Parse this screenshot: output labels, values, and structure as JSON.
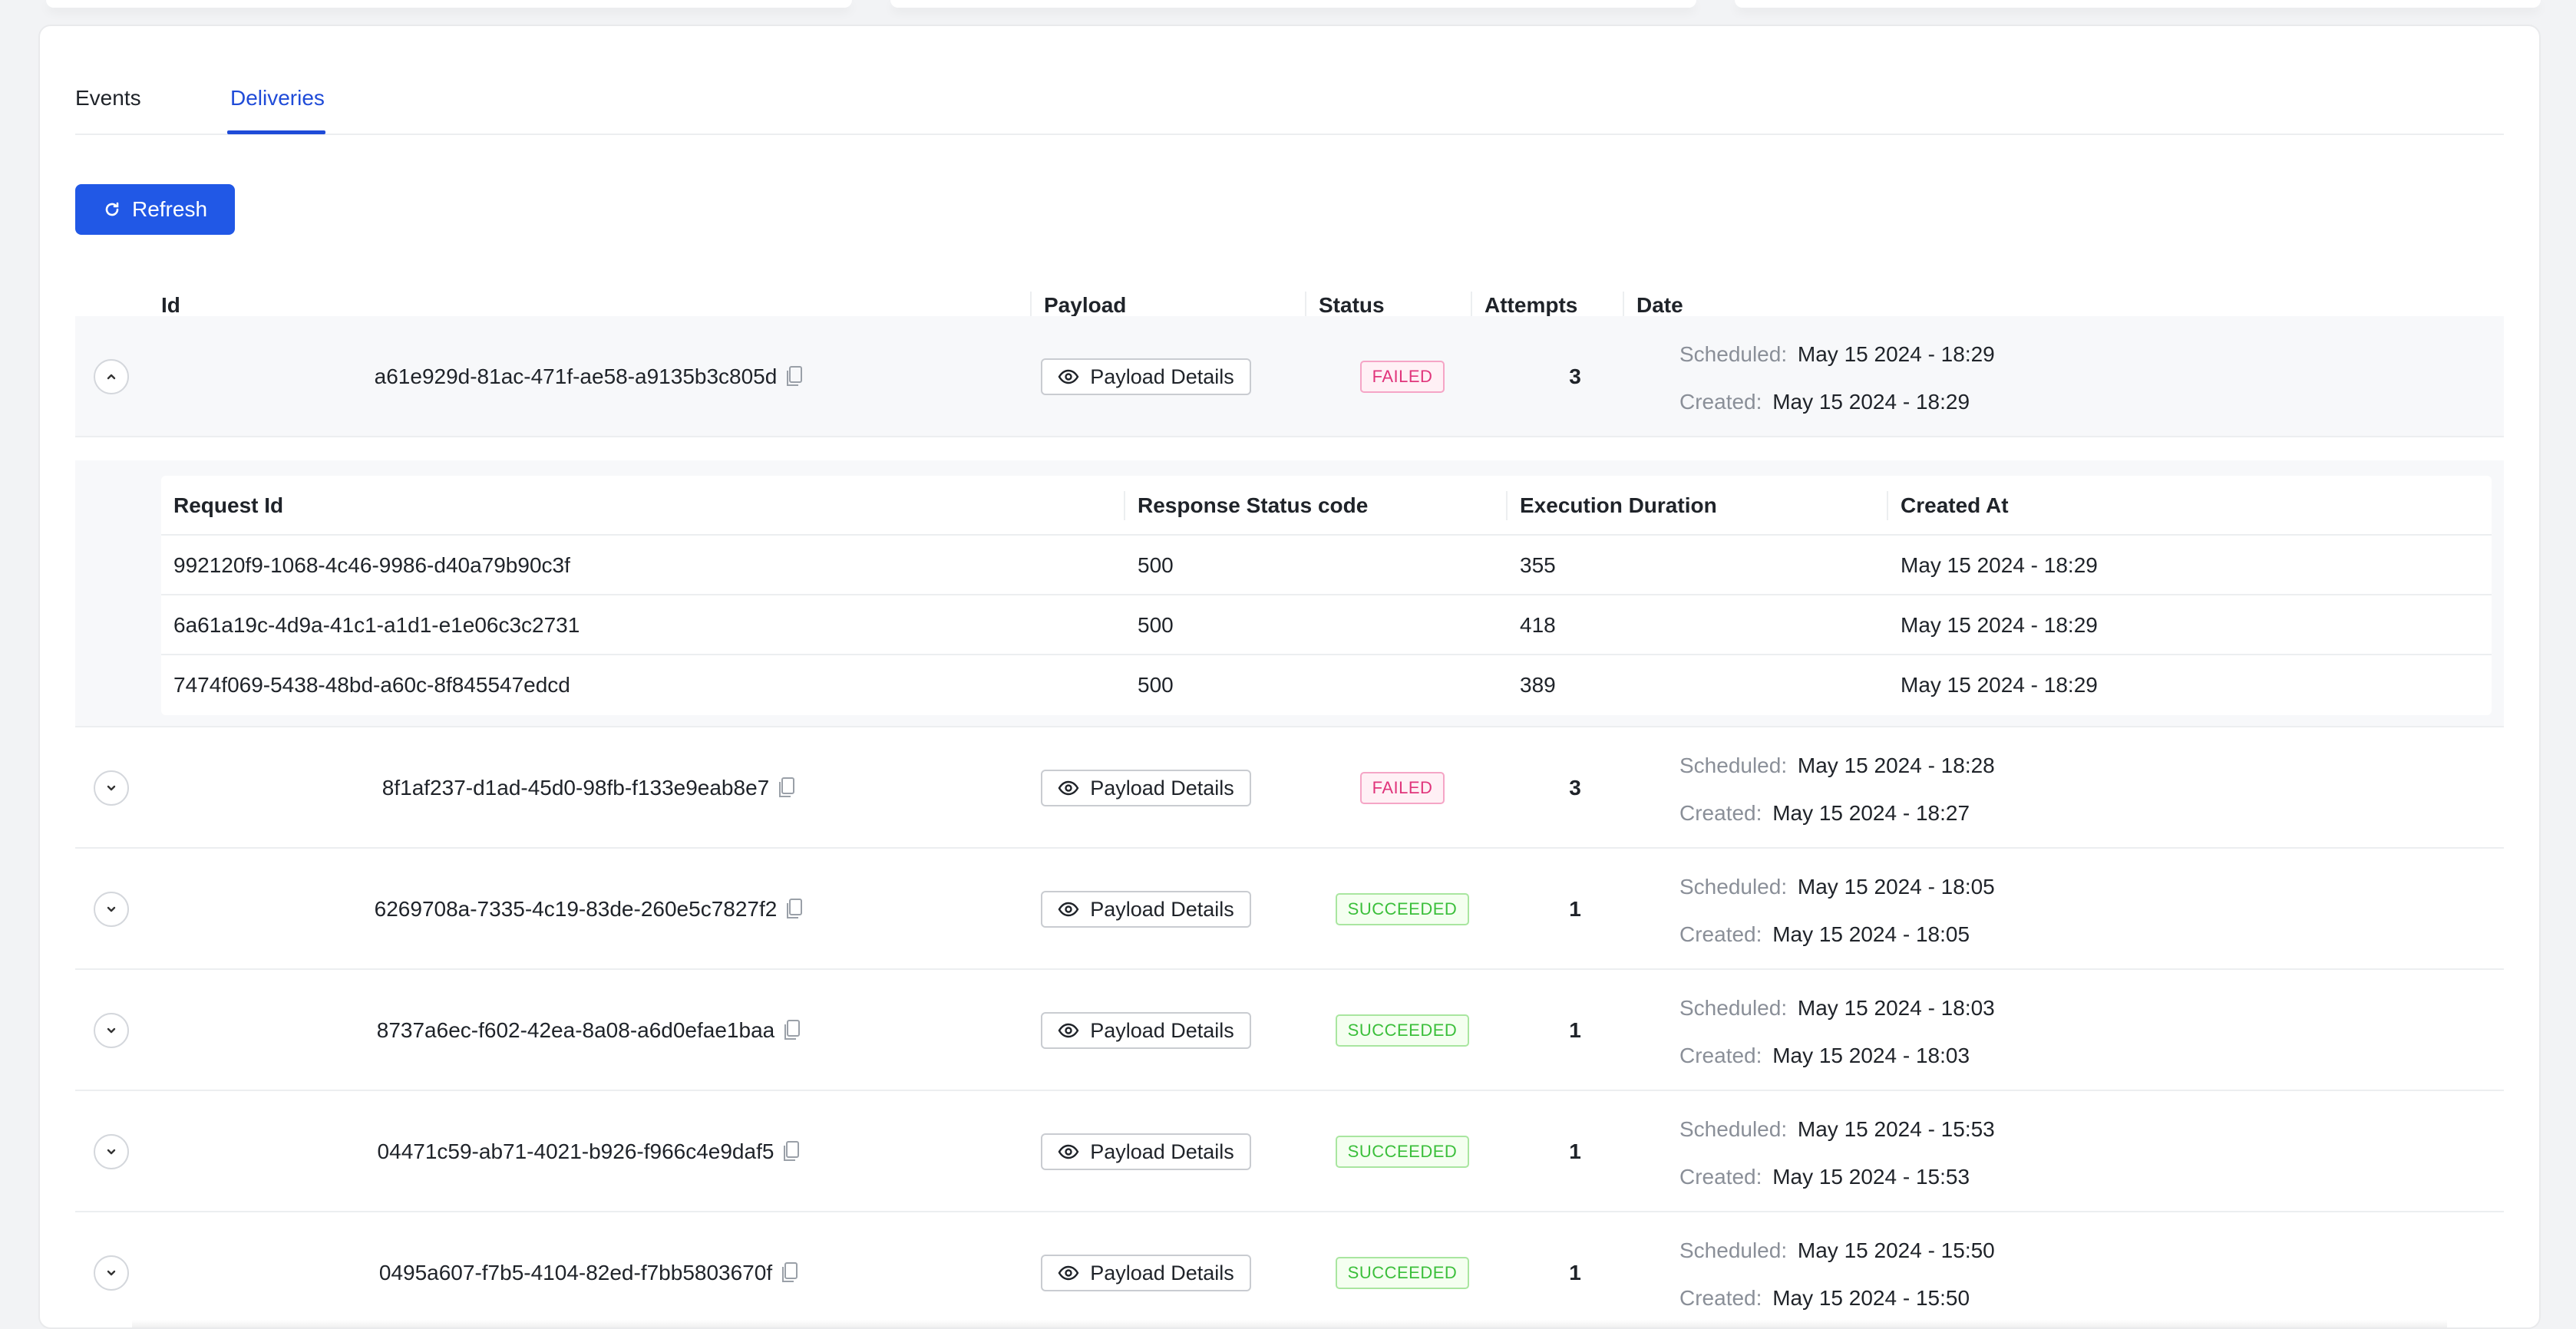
{
  "tabs": [
    {
      "label": "Events",
      "active": false
    },
    {
      "label": "Deliveries",
      "active": true
    }
  ],
  "toolbar": {
    "refresh_label": "Refresh"
  },
  "table": {
    "columns": [
      "Id",
      "Payload",
      "Status",
      "Attempts",
      "Date"
    ],
    "scheduled_key": "Scheduled",
    "created_key": "Created",
    "payload_label": "Payload Details",
    "rows": [
      {
        "id": "a61e929d-81ac-471f-ae58-a9135b3c805d",
        "status": "FAILED",
        "attempts": "3",
        "scheduled": "May 15 2024 - 18:29",
        "created": "May 15 2024 - 18:29",
        "expanded": true
      },
      {
        "id": "8f1af237-d1ad-45d0-98fb-f133e9eab8e7",
        "status": "FAILED",
        "attempts": "3",
        "scheduled": "May 15 2024 - 18:28",
        "created": "May 15 2024 - 18:27",
        "expanded": false
      },
      {
        "id": "6269708a-7335-4c19-83de-260e5c7827f2",
        "status": "SUCCEEDED",
        "attempts": "1",
        "scheduled": "May 15 2024 - 18:05",
        "created": "May 15 2024 - 18:05",
        "expanded": false
      },
      {
        "id": "8737a6ec-f602-42ea-8a08-a6d0efae1baa",
        "status": "SUCCEEDED",
        "attempts": "1",
        "scheduled": "May 15 2024 - 18:03",
        "created": "May 15 2024 - 18:03",
        "expanded": false
      },
      {
        "id": "04471c59-ab71-4021-b926-f966c4e9daf5",
        "status": "SUCCEEDED",
        "attempts": "1",
        "scheduled": "May 15 2024 - 15:53",
        "created": "May 15 2024 - 15:53",
        "expanded": false
      },
      {
        "id": "0495a607-f7b5-4104-82ed-f7bb5803670f",
        "status": "SUCCEEDED",
        "attempts": "1",
        "scheduled": "May 15 2024 - 15:50",
        "created": "May 15 2024 - 15:50",
        "expanded": false
      }
    ]
  },
  "attempts_table": {
    "columns": [
      "Request Id",
      "Response Status code",
      "Execution Duration",
      "Created At"
    ],
    "rows": [
      {
        "request_id": "992120f9-1068-4c46-9986-d40a79b90c3f",
        "status_code": "500",
        "duration": "355",
        "created_at": "May 15 2024 - 18:29"
      },
      {
        "request_id": "6a61a19c-4d9a-41c1-a1d1-e1e06c3c2731",
        "status_code": "500",
        "duration": "418",
        "created_at": "May 15 2024 - 18:29"
      },
      {
        "request_id": "7474f069-5438-48bd-a60c-8f845547edcd",
        "status_code": "500",
        "duration": "389",
        "created_at": "May 15 2024 - 18:29"
      }
    ]
  },
  "colors": {
    "accent": "#2158e6",
    "failed": "#e0347b",
    "succeeded": "#3bbf3b"
  },
  "icons": {
    "refresh": "refresh-icon",
    "expand": "chevron-down-icon",
    "collapse": "chevron-up-icon",
    "copy": "copy-icon",
    "payload": "eye-icon"
  }
}
